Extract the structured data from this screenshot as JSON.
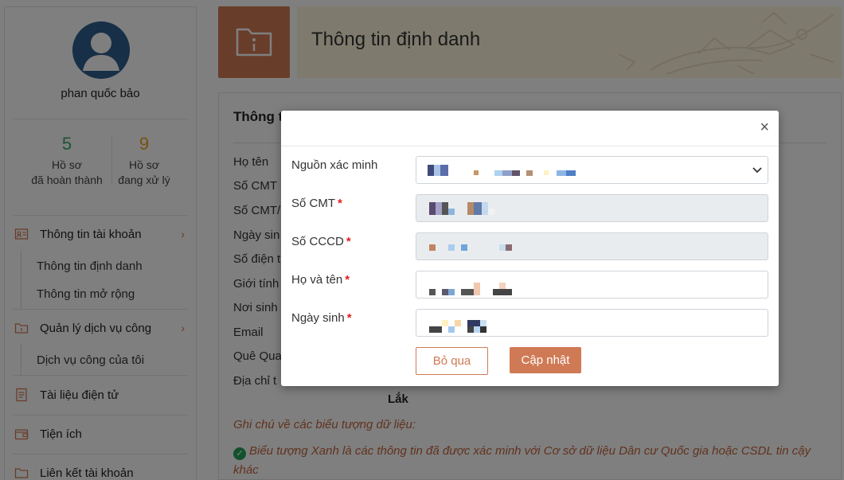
{
  "sidebar": {
    "username": "phan quốc bảo",
    "stats": [
      {
        "value": "5",
        "label_line1": "Hồ sơ",
        "label_line2": "đã hoàn thành"
      },
      {
        "value": "9",
        "label_line1": "Hồ sơ",
        "label_line2": "đang xử lý"
      }
    ],
    "menu": {
      "account": "Thông tin tài khoản",
      "account_sub1": "Thông tin định danh",
      "account_sub2": "Thông tin mở rộng",
      "services": "Quản lý dịch vụ công",
      "services_sub1": "Dịch vụ công của tôi",
      "documents": "Tài liệu điện tử",
      "utilities": "Tiện ích",
      "linked": "Liên kết tài khoản"
    },
    "chevron": "›"
  },
  "header": {
    "title": "Thông tin định danh"
  },
  "background": {
    "section_title": "Thông t",
    "labels": [
      "Họ tên",
      "Số CMT",
      "Số CMT/",
      "Ngày sin",
      "Số điện t",
      "Giới tính",
      "Nơi sinh",
      "Email",
      "Quê Qua",
      "Địa chỉ t"
    ],
    "value_fragment": "Lắk",
    "note_title": "Ghi chú về các biểu tượng dữ liệu:",
    "note_green": "Biểu tượng Xanh là các thông tin đã được xác minh với Cơ sở dữ liệu Dân cư Quốc gia hoặc CSDL tin cậy khác"
  },
  "modal": {
    "close": "×",
    "fields": [
      {
        "label": "Nguồn xác minh",
        "required": false
      },
      {
        "label": "Số CMT",
        "required": true
      },
      {
        "label": "Số CCCD",
        "required": true
      },
      {
        "label": "Họ và tên",
        "required": true
      },
      {
        "label": "Ngày sinh",
        "required": true
      }
    ],
    "required_mark": "*",
    "skip_label": "Bỏ qua",
    "save_label": "Cập nhật"
  },
  "colors": {
    "accent": "#d07a55",
    "done": "#3aa86b",
    "processing": "#f0a020",
    "banner": "#fdf6dc",
    "avatar": "#2f5f8f"
  }
}
